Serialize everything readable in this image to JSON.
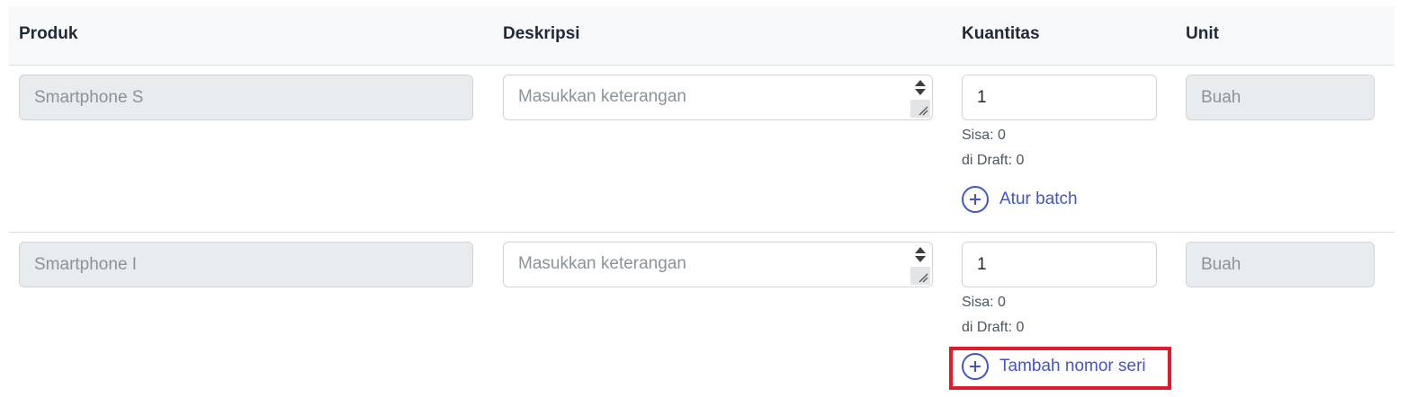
{
  "headers": {
    "produk": "Produk",
    "deskripsi": "Deskripsi",
    "kuantitas": "Kuantitas",
    "unit": "Unit"
  },
  "rows": [
    {
      "produk": "Smartphone S",
      "deskripsi_placeholder": "Masukkan keterangan",
      "kuantitas": "1",
      "unit": "Buah",
      "sisa": "Sisa: 0",
      "draft": "di Draft: 0",
      "action_label": "Atur batch",
      "action_icon": "plus-circle-icon"
    },
    {
      "produk": "Smartphone I",
      "deskripsi_placeholder": "Masukkan keterangan",
      "kuantitas": "1",
      "unit": "Buah",
      "sisa": "Sisa: 0",
      "draft": "di Draft: 0",
      "action_label": "Tambah nomor seri",
      "action_icon": "plus-circle-icon"
    }
  ],
  "colors": {
    "accent": "#4255c8",
    "highlight": "#e21b2c"
  }
}
